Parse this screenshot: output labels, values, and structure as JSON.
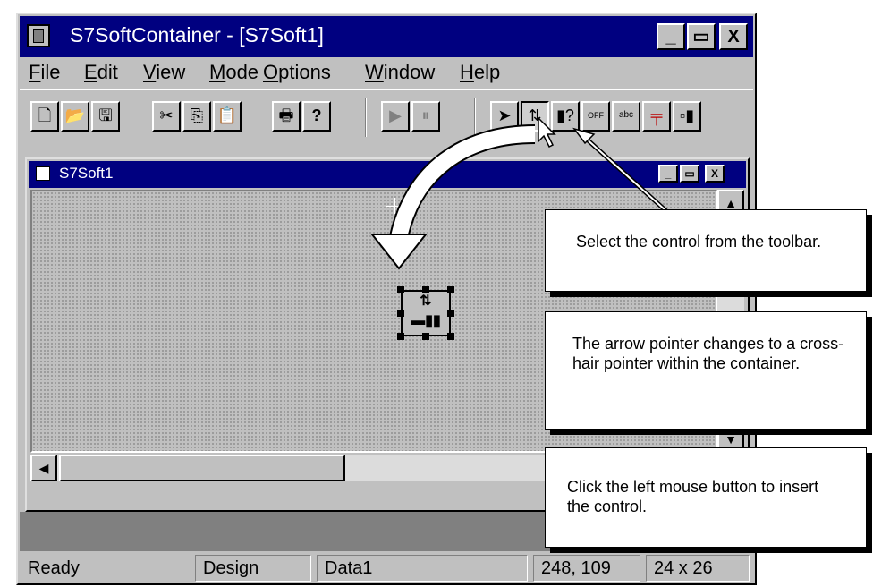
{
  "window": {
    "title": "S7SoftContainer - [S7Soft1]"
  },
  "menu": [
    {
      "label": "File",
      "mnemonic": "F",
      "rest": "ile"
    },
    {
      "label": "Edit",
      "mnemonic": "E",
      "rest": "dit"
    },
    {
      "label": "View",
      "mnemonic": "V",
      "rest": "iew"
    },
    {
      "label": "Mode",
      "mnemonic": "M",
      "rest": "ode"
    },
    {
      "label": "Options",
      "mnemonic": "O",
      "rest": "ptions"
    },
    {
      "label": "Window",
      "mnemonic": "W",
      "rest": "indow"
    },
    {
      "label": "Help",
      "mnemonic": "H",
      "rest": "elp"
    }
  ],
  "toolbar": {
    "buttons": [
      "new-file-icon",
      "open-folder-icon",
      "save-disk-icon",
      "cut-scissors-icon",
      "copy-icon",
      "paste-icon",
      "print-icon",
      "help-question-icon",
      "run-icon",
      "pause-icon",
      "select-arrow-icon",
      "control-updown-icon",
      "control-toggle-icon",
      "control-off-icon",
      "control-abc-icon",
      "control-slider-icon",
      "control-display-icon"
    ],
    "help_label": "?",
    "off_label": "OFF",
    "abc_label": "abc"
  },
  "child_window": {
    "title": "S7Soft1"
  },
  "status": {
    "state": "Ready",
    "mode": "Design",
    "data": "Data1",
    "coords": "248, 109",
    "size": "24 x 26"
  },
  "callouts": {
    "select": "Select the control from the toolbar.",
    "pointer": "The arrow pointer changes to a cross-hair pointer within the container.",
    "click": "Click the left mouse button to insert the control."
  }
}
